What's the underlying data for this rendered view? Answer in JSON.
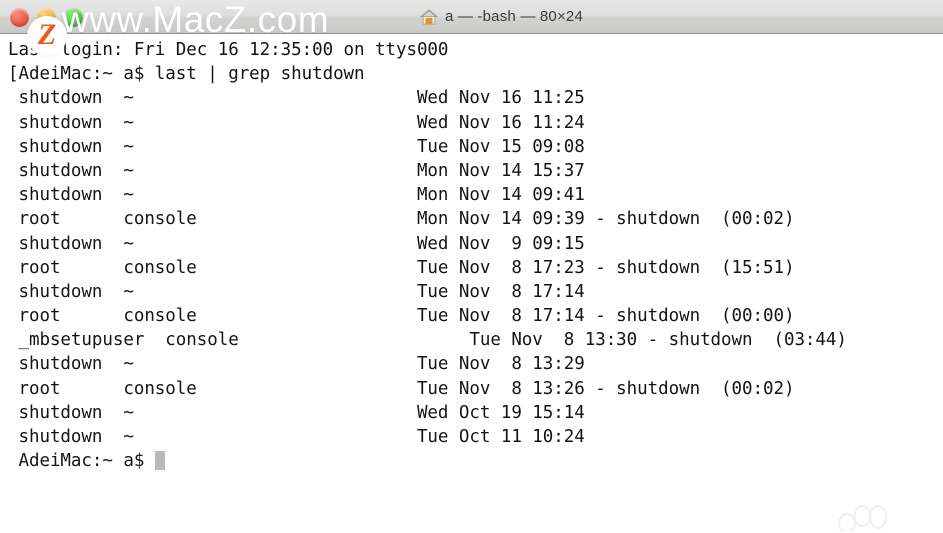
{
  "window": {
    "title": "a — -bash — 80×24",
    "icon": "home-icon",
    "traffic_lights": [
      {
        "name": "close",
        "label": "Close",
        "color": "#e8503f"
      },
      {
        "name": "minimize",
        "label": "Minimize",
        "color": "#e9a321"
      },
      {
        "name": "maximize",
        "label": "Maximize",
        "color": "#3fb63a"
      }
    ]
  },
  "watermark": {
    "logo_letter": "Z",
    "text": "www.MacZ.com",
    "logo_color": "#ef5a1e"
  },
  "terminal": {
    "background": "#ffffff",
    "foreground": "#141414",
    "cursor_color": "#b9b9b9",
    "login_line": "Last login: Fri Dec 16 12:35:00 on ttys000",
    "command_prompt": "[AdeiMac:~ a$ ",
    "command": "last | grep shutdown",
    "final_prompt": "AdeiMac:~ a$ ",
    "lines": [
      "Last login: Fri Dec 16 12:35:00 on ttys000",
      "[AdeiMac:~ a$ last | grep shutdown",
      " shutdown  ~                           Wed Nov 16 11:25",
      " shutdown  ~                           Wed Nov 16 11:24",
      " shutdown  ~                           Tue Nov 15 09:08",
      " shutdown  ~                           Mon Nov 14 15:37",
      " shutdown  ~                           Mon Nov 14 09:41",
      " root      console                     Mon Nov 14 09:39 - shutdown  (00:02)",
      " shutdown  ~                           Wed Nov  9 09:15",
      " root      console                     Tue Nov  8 17:23 - shutdown  (15:51)",
      " shutdown  ~                           Tue Nov  8 17:14",
      " root      console                     Tue Nov  8 17:14 - shutdown  (00:00)",
      " _mbsetupuser  console                      Tue Nov  8 13:30 - shutdown  (03:44)",
      " shutdown  ~                           Tue Nov  8 13:29",
      " root      console                     Tue Nov  8 13:26 - shutdown  (00:02)",
      " shutdown  ~                           Wed Oct 19 15:14",
      " shutdown  ~                           Tue Oct 11 10:24",
      " AdeiMac:~ a$ "
    ],
    "records": [
      {
        "user": "shutdown",
        "tty": "~",
        "date": "Wed Nov 16 11:25",
        "logout": "",
        "duration": ""
      },
      {
        "user": "shutdown",
        "tty": "~",
        "date": "Wed Nov 16 11:24",
        "logout": "",
        "duration": ""
      },
      {
        "user": "shutdown",
        "tty": "~",
        "date": "Tue Nov 15 09:08",
        "logout": "",
        "duration": ""
      },
      {
        "user": "shutdown",
        "tty": "~",
        "date": "Mon Nov 14 15:37",
        "logout": "",
        "duration": ""
      },
      {
        "user": "shutdown",
        "tty": "~",
        "date": "Mon Nov 14 09:41",
        "logout": "",
        "duration": ""
      },
      {
        "user": "root",
        "tty": "console",
        "date": "Mon Nov 14 09:39",
        "logout": "- shutdown",
        "duration": "(00:02)"
      },
      {
        "user": "shutdown",
        "tty": "~",
        "date": "Wed Nov  9 09:15",
        "logout": "",
        "duration": ""
      },
      {
        "user": "root",
        "tty": "console",
        "date": "Tue Nov  8 17:23",
        "logout": "- shutdown",
        "duration": "(15:51)"
      },
      {
        "user": "shutdown",
        "tty": "~",
        "date": "Tue Nov  8 17:14",
        "logout": "",
        "duration": ""
      },
      {
        "user": "root",
        "tty": "console",
        "date": "Tue Nov  8 17:14",
        "logout": "- shutdown",
        "duration": "(00:00)"
      },
      {
        "user": "_mbsetupuser",
        "tty": "console",
        "date": "Tue Nov  8 13:30",
        "logout": "- shutdown",
        "duration": "(03:44)"
      },
      {
        "user": "shutdown",
        "tty": "~",
        "date": "Tue Nov  8 13:29",
        "logout": "",
        "duration": ""
      },
      {
        "user": "root",
        "tty": "console",
        "date": "Tue Nov  8 13:26",
        "logout": "- shutdown",
        "duration": "(00:02)"
      },
      {
        "user": "shutdown",
        "tty": "~",
        "date": "Wed Oct 19 15:14",
        "logout": "",
        "duration": ""
      },
      {
        "user": "shutdown",
        "tty": "~",
        "date": "Tue Oct 11 10:24",
        "logout": "",
        "duration": ""
      }
    ]
  }
}
